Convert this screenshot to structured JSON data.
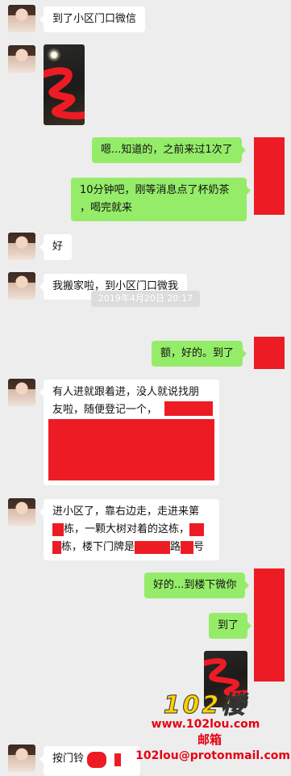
{
  "messages": [
    {
      "text": "到了小区门口微信"
    },
    {
      "text": "嗯...知道的，之前来过1次了"
    },
    {
      "text_line1": "10分钟吧，刚等消息点了杯奶茶",
      "text_line2": "，喝完就来"
    },
    {
      "text": "好"
    },
    {
      "text": "我搬家啦，到小区门口微我"
    },
    {
      "text": "额，好的。到了"
    },
    {
      "text_line1": "有人进就跟着进，没人就说找朋",
      "text_line2": "友啦，随便登记一个，"
    },
    {
      "text_line1": "进小区了，靠右边走，走进来第",
      "text_line2": "栋，一颗大树对着的这栋，",
      "text_line3_a": "栋，楼下门牌是",
      "text_line3_b": "路",
      "text_line3_c": "号"
    },
    {
      "text": "好的...到楼下微你"
    },
    {
      "text": "到了"
    },
    {
      "text": "按门铃"
    }
  ],
  "timestamp": "2019年4月20日 20:17",
  "watermark": {
    "brand": "102楼",
    "site": "www.102lou.com",
    "label": "邮箱",
    "email": "102lou@protonmail.com"
  },
  "colors": {
    "background": "#ededed",
    "incoming_bubble": "#ffffff",
    "outgoing_bubble": "#95ec69",
    "redaction": "#ed1c24",
    "watermark_yellow": "#ffd200",
    "watermark_red": "#e60012"
  }
}
